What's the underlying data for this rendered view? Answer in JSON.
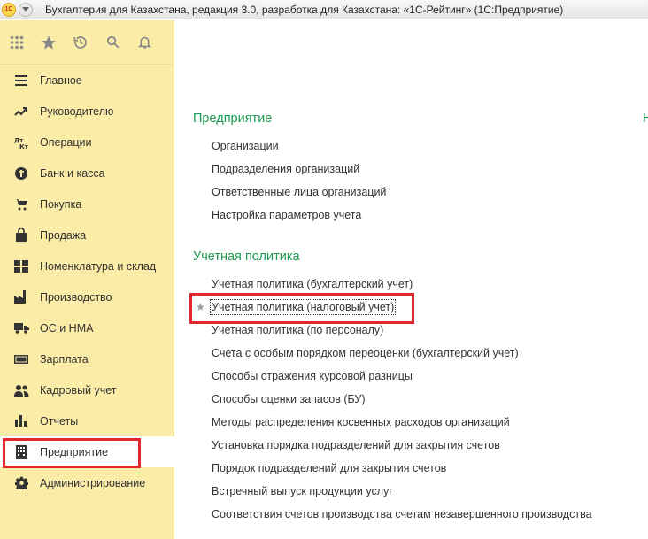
{
  "window": {
    "logo_text": "1С",
    "title": "Бухгалтерия для Казахстана, редакция 3.0, разработка для Казахстана: «1С-Рейтинг»  (1С:Предприятие)"
  },
  "sidebar": {
    "toolbar": [
      {
        "name": "apps-grid-icon"
      },
      {
        "name": "favorites-star-icon"
      },
      {
        "name": "history-icon"
      },
      {
        "name": "search-icon"
      },
      {
        "name": "notifications-bell-icon"
      }
    ],
    "items": [
      {
        "label": "Главное",
        "icon": "menu-lines-icon"
      },
      {
        "label": "Руководителю",
        "icon": "trend-chart-icon"
      },
      {
        "label": "Операции",
        "icon": "debit-credit-icon"
      },
      {
        "label": "Банк и касса",
        "icon": "coin-icon"
      },
      {
        "label": "Покупка",
        "icon": "shopping-cart-icon"
      },
      {
        "label": "Продажа",
        "icon": "shopping-bag-icon"
      },
      {
        "label": "Номенклатура и склад",
        "icon": "grid-blocks-icon"
      },
      {
        "label": "Производство",
        "icon": "factory-icon"
      },
      {
        "label": "ОС и НМА",
        "icon": "truck-icon"
      },
      {
        "label": "Зарплата",
        "icon": "money-icon"
      },
      {
        "label": "Кадровый учет",
        "icon": "people-icon"
      },
      {
        "label": "Отчеты",
        "icon": "bar-chart-icon"
      },
      {
        "label": "Предприятие",
        "icon": "building-icon",
        "active": true
      },
      {
        "label": "Администрирование",
        "icon": "gear-icon"
      }
    ]
  },
  "main": {
    "section_enterprise": {
      "title": "Предприятие",
      "links": [
        "Организации",
        "Подразделения организаций",
        "Ответственные лица организаций",
        "Настройка параметров учета"
      ]
    },
    "section_policy": {
      "title": "Учетная политика",
      "links": [
        "Учетная политика (бухгалтерский учет)",
        "Учетная политика (налоговый учет)",
        "Учетная политика (по персоналу)",
        "Счета с особым порядком переоценки (бухгалтерский учет)",
        "Способы отражения курсовой разницы",
        "Способы оценки запасов (БУ)",
        "Методы распределения косвенных расходов организаций",
        "Установка порядка подразделений для закрытия счетов",
        "Порядок подразделений для закрытия счетов",
        "Встречный выпуск продукции услуг",
        "Соответствия счетов производства счетам незавершенного производства"
      ]
    },
    "edge_letter": "Н",
    "star_glyph": "★"
  },
  "colors": {
    "sidebar_bg": "#fbeca7",
    "section_title": "#1e9a52",
    "highlight": "#e0262f"
  }
}
